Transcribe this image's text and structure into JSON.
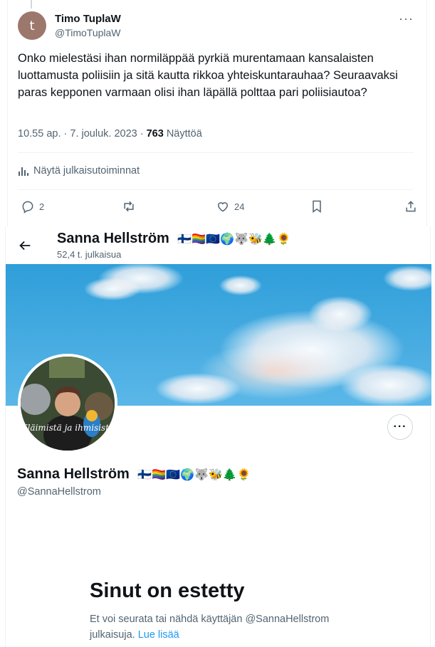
{
  "tweet": {
    "author_initial": "t",
    "author_name": "Timo TuplaW",
    "author_handle": "@TimoTuplaW",
    "more_label": "···",
    "text": "Onko mielestäsi ihan normiläppää pyrkiä murentamaan kansalaisten luottamusta poliisiin ja sitä kautta rikkoa yhteiskuntarauhaa? Seuraavaksi paras kepponen varmaan olisi ihan läpällä polttaa pari poliisiautoa?",
    "time": "10.55 ap.",
    "date": "7. jouluk. 2023",
    "views_count": "763",
    "views_label": "Näyttöä",
    "activity_label": "Näytä julkaisutoiminnat",
    "replies": "2",
    "likes": "24"
  },
  "profile": {
    "display_name": "Sanna Hellström",
    "name_emojis": "🇫🇮🏳️‍🌈🇪🇺🌍🐺🐝🌲🌻",
    "post_count": "52,4 t. julkaisua",
    "handle": "@SannaHellstrom",
    "avatar_caption": "Eläimistä ja ihmisistä",
    "more_label": "···",
    "blocked_title": "Sinut on estetty",
    "blocked_text": "Et voi seurata tai nähdä käyttäjän @SannaHellstrom julkaisuja.",
    "learn_more": "Lue lisää"
  },
  "colors": {
    "accent": "#1d9bf0",
    "secondary_text": "#536471",
    "sky": "#3fa8e0"
  }
}
